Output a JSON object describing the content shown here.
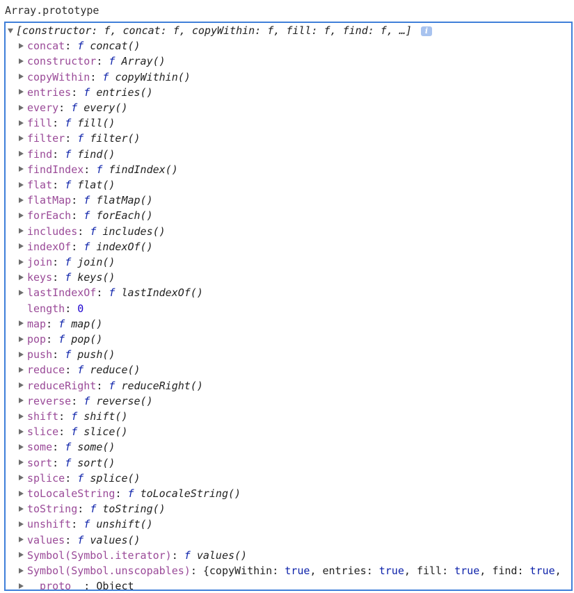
{
  "console": {
    "input": "Array.prototype",
    "summary": "[constructor: f, concat: f, copyWithin: f, fill: f, find: f, …]",
    "info_icon": "i"
  },
  "properties": [
    {
      "key": "concat",
      "type": "fn",
      "value": "concat()"
    },
    {
      "key": "constructor",
      "type": "fn",
      "value": "Array()"
    },
    {
      "key": "copyWithin",
      "type": "fn",
      "value": "copyWithin()"
    },
    {
      "key": "entries",
      "type": "fn",
      "value": "entries()"
    },
    {
      "key": "every",
      "type": "fn",
      "value": "every()"
    },
    {
      "key": "fill",
      "type": "fn",
      "value": "fill()"
    },
    {
      "key": "filter",
      "type": "fn",
      "value": "filter()"
    },
    {
      "key": "find",
      "type": "fn",
      "value": "find()"
    },
    {
      "key": "findIndex",
      "type": "fn",
      "value": "findIndex()"
    },
    {
      "key": "flat",
      "type": "fn",
      "value": "flat()"
    },
    {
      "key": "flatMap",
      "type": "fn",
      "value": "flatMap()"
    },
    {
      "key": "forEach",
      "type": "fn",
      "value": "forEach()"
    },
    {
      "key": "includes",
      "type": "fn",
      "value": "includes()"
    },
    {
      "key": "indexOf",
      "type": "fn",
      "value": "indexOf()"
    },
    {
      "key": "join",
      "type": "fn",
      "value": "join()"
    },
    {
      "key": "keys",
      "type": "fn",
      "value": "keys()"
    },
    {
      "key": "lastIndexOf",
      "type": "fn",
      "value": "lastIndexOf()"
    },
    {
      "key": "length",
      "type": "num",
      "value": "0"
    },
    {
      "key": "map",
      "type": "fn",
      "value": "map()"
    },
    {
      "key": "pop",
      "type": "fn",
      "value": "pop()"
    },
    {
      "key": "push",
      "type": "fn",
      "value": "push()"
    },
    {
      "key": "reduce",
      "type": "fn",
      "value": "reduce()"
    },
    {
      "key": "reduceRight",
      "type": "fn",
      "value": "reduceRight()"
    },
    {
      "key": "reverse",
      "type": "fn",
      "value": "reverse()"
    },
    {
      "key": "shift",
      "type": "fn",
      "value": "shift()"
    },
    {
      "key": "slice",
      "type": "fn",
      "value": "slice()"
    },
    {
      "key": "some",
      "type": "fn",
      "value": "some()"
    },
    {
      "key": "sort",
      "type": "fn",
      "value": "sort()"
    },
    {
      "key": "splice",
      "type": "fn",
      "value": "splice()"
    },
    {
      "key": "toLocaleString",
      "type": "fn",
      "value": "toLocaleString()"
    },
    {
      "key": "toString",
      "type": "fn",
      "value": "toString()"
    },
    {
      "key": "unshift",
      "type": "fn",
      "value": "unshift()"
    },
    {
      "key": "values",
      "type": "fn",
      "value": "values()"
    },
    {
      "key": "Symbol(Symbol.iterator)",
      "type": "fn",
      "value": "values()"
    },
    {
      "key": "Symbol(Symbol.unscopables)",
      "type": "obj",
      "pairs": [
        {
          "k": "copyWithin",
          "v": "true"
        },
        {
          "k": "entries",
          "v": "true"
        },
        {
          "k": "fill",
          "v": "true"
        },
        {
          "k": "find",
          "v": "true"
        }
      ],
      "trailing": ","
    },
    {
      "key": "__proto__",
      "type": "plain",
      "value": "Object"
    }
  ],
  "labels": {
    "f": "f",
    "colon": ":"
  },
  "colors": {
    "panel_border": "#3f7fd9",
    "key": "#9a4a98",
    "function_f": "#0d22aa",
    "number": "#1c00cf",
    "info_badge": "#a8c3ef"
  }
}
